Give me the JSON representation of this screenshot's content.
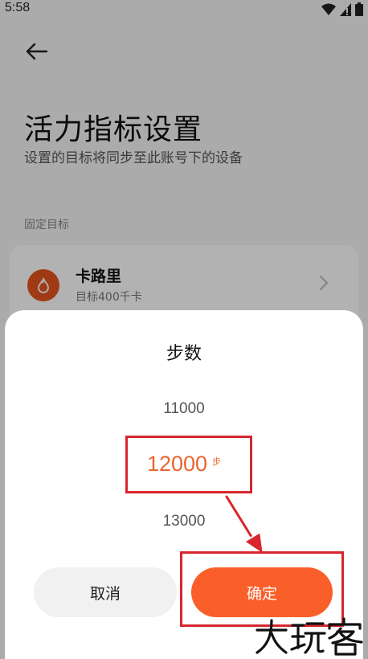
{
  "status_bar": {
    "time": "5:58"
  },
  "page": {
    "title": "活力指标设置",
    "subtitle": "设置的目标将同步至此账号下的设备",
    "section_label": "固定目标",
    "goal": {
      "name": "卡路里",
      "description": "目标400千卡"
    }
  },
  "sheet": {
    "title": "步数",
    "picker": {
      "above": "11000",
      "selected": "12000",
      "unit": "步",
      "below": "13000"
    },
    "cancel_label": "取消",
    "confirm_label": "确定"
  },
  "colors": {
    "accent": "#fa5f2a",
    "selected_text": "#e8652f",
    "annotation": "#d7262e"
  },
  "icons": [
    "back-arrow-icon",
    "wifi-icon",
    "signal-icon",
    "battery-icon",
    "flame-icon",
    "chevron-right-icon"
  ],
  "watermark": "大玩客"
}
